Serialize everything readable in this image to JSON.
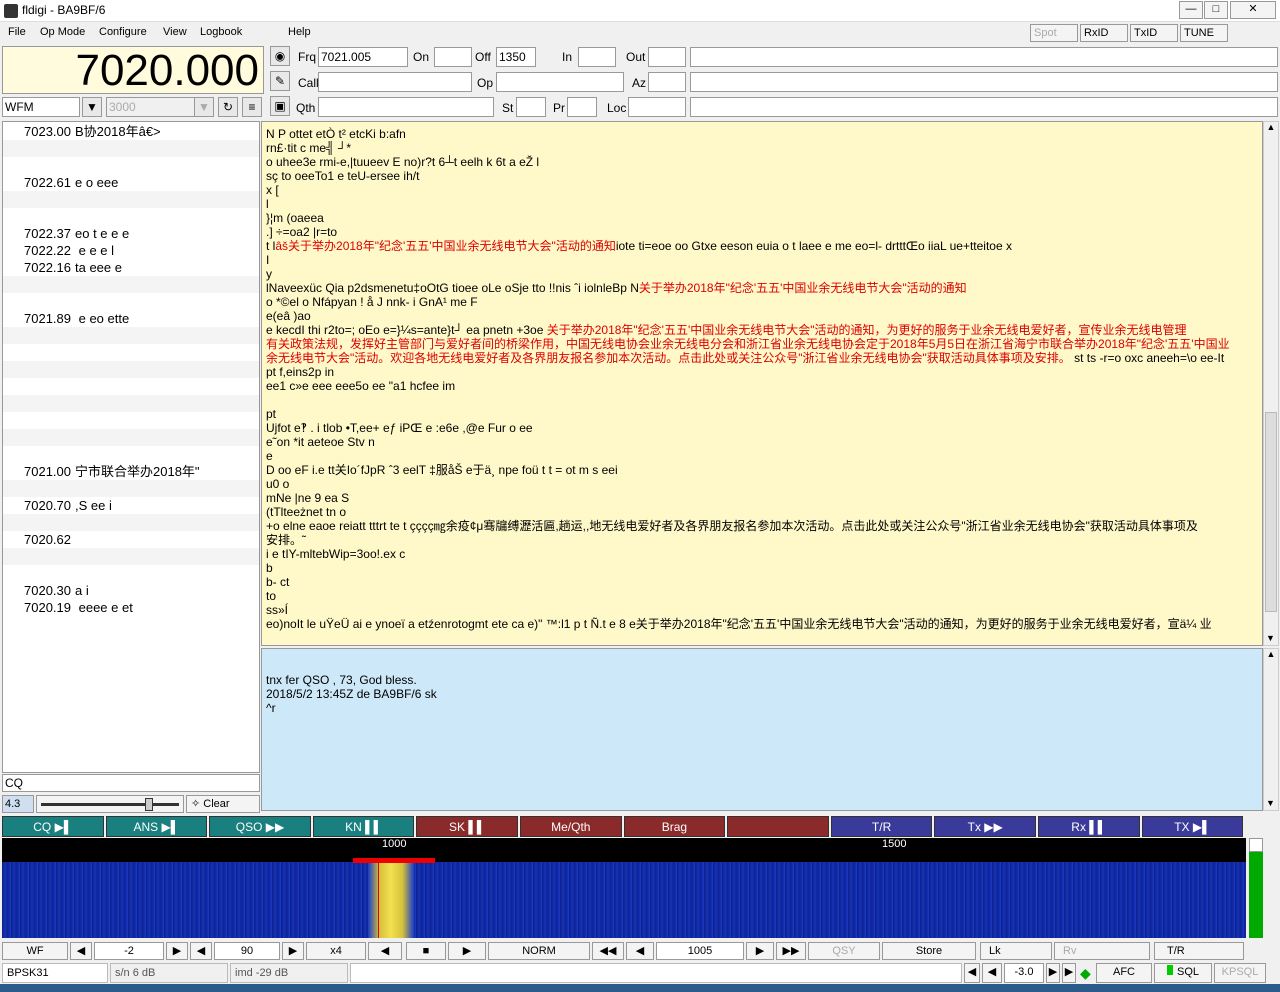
{
  "window": {
    "title": "fldigi - BA9BF/6"
  },
  "menu": [
    "File",
    "Op Mode",
    "Configure",
    "View",
    "Logbook",
    "Help"
  ],
  "toolbar_right": [
    "Spot",
    "RxID",
    "TxID",
    "TUNE"
  ],
  "freq": {
    "display": "7020.000",
    "mode": "WFM",
    "bandwidth": "3000"
  },
  "log": {
    "frq_label": "Frq",
    "frq": "7021.005",
    "on_label": "On",
    "on": "",
    "off_label": "Off",
    "off": "1350",
    "in_label": "In",
    "in": "",
    "out_label": "Out",
    "out": "",
    "call_label": "Call",
    "call": "",
    "op_label": "Op",
    "op": "",
    "az_label": "Az",
    "az": "",
    "qth_label": "Qth",
    "qth": "",
    "st_label": "St",
    "st": "",
    "pr_label": "Pr",
    "pr": "",
    "loc_label": "Loc",
    "loc": ""
  },
  "browser": [
    {
      "f": "7023.00",
      "t": "B协2018年â€>"
    },
    {
      "f": "7022.61",
      "t": "e  o    eee"
    },
    {
      "f": "7022.37",
      "t": "eo  t e e e"
    },
    {
      "f": "7022.22",
      "t": " e   e e l"
    },
    {
      "f": "7022.16",
      "t": "ta eee    e"
    },
    {
      "f": "7021.89",
      "t": " e  eo  ette"
    },
    {
      "f": "7021.00",
      "t": "宁市联合举办2018年\""
    },
    {
      "f": "7020.70",
      "t": ",S  ee i"
    },
    {
      "f": "7020.62",
      "t": ""
    },
    {
      "f": "7020.30",
      "t": "a i"
    },
    {
      "f": "7020.19",
      "t": " eeee    e et"
    }
  ],
  "rx_lines": [
    {
      "t": "N P  ottet  etÒ t² etcKi b:afn",
      "r": ""
    },
    {
      "t": " rn£·tit c me╣ ┘*",
      "r": ""
    },
    {
      "t": "o uhee3e rmi-e,|tuueev E no)r?t  6┴t eelh k 6t  a    eŽ l",
      "r": ""
    },
    {
      "t": "sç  to oeeTo1  e teU-ersee ih/t",
      "r": ""
    },
    {
      "t": "x [",
      "r": ""
    },
    {
      "t": "l",
      "r": ""
    },
    {
      "t": "}¦m  (oaeea",
      "r": ""
    },
    {
      "t": ".] ÷=oa2 |r=to",
      "r": ""
    },
    {
      "t": "t l",
      "r": "âš关于举办2018年\"纪念'五五'中国业余无线电节大会\"活动的通知",
      "t2": "iote ti=eoe oo Gtxe eeson euia    o t           laee    e  me eo=l-   drtttŒo iiaL ue+tteitoe x"
    },
    {
      "t": "I",
      "r": ""
    },
    {
      "t": "y",
      "r": ""
    },
    {
      "t": "lNaveexüc Qia p2dsmenetu‡oOtG tioee  oLe oSje  tto !!nis ˆi iolnleBp N",
      "r": "关于举办2018年\"纪念'五五'中国业余无线电节大会\"活动的通知"
    },
    {
      "t": "o *©el o Nfápyan ! å J nnk- i GnA¹ me F",
      "r": ""
    },
    {
      "t": "e(eâ )ao",
      "r": ""
    },
    {
      "t": "e  kecdI   thi r2to=; oEo    e=}¼s=ante}t┘ ea pnetn  +3oe ",
      "r": "关于举办2018年\"纪念'五五'中国业余无线电节大会\"活动的通知，为更好的服务于业余无线电爱好者，宣传业余无线电管理"
    },
    {
      "t": "",
      "r": "有关政策法规，发挥好主管部门与爱好者间的桥梁作用，中国无线电协会业余无线电分会和浙江省业余无线电协会定于2018年5月5日在浙江省海宁市联合举办2018年\"纪念'五五'中国业"
    },
    {
      "t": "",
      "r": "余无线电节大会\"活动。欢迎各地无线电爱好者及各界朋友报名参加本次活动。点击此处或关注公众号\"浙江省业余无线电协会\"获取活动具体事项及安排。",
      "t2": " st   ts -r=o oxc aneeh=\\o ee-It"
    },
    {
      "t": "pt  f,eins2p in",
      "r": ""
    },
    {
      "t": "ee1  c»e eee eee5o   ee \"a1     hcfee im",
      "r": ""
    },
    {
      "t": "",
      "r": ""
    },
    {
      "t": "pt",
      "r": ""
    },
    {
      "t": "Ujfot  e‽ . i    tlob •T,ee+ eƒ iPŒ e  :e6e  ,@e Fur o   ee",
      "r": ""
    },
    {
      "t": "e˜on *it  aeteoe  Stv    n",
      "r": ""
    },
    {
      "t": " e",
      "r": ""
    },
    {
      "t": "D oo   eF  i.e tt关Io´fJpR   ˆ3    eelT ‡服åŠ  e于ä¸ npe  foü                                                     t t                      =    ot  m s eei",
      "r": ""
    },
    {
      "t": " u0 o",
      "r": ""
    },
    {
      "t": " mNe |ne 9 ea S",
      "r": ""
    },
    {
      "t": "(tTlteeżnet tn o",
      "r": ""
    },
    {
      "t": "+o  elne eaoe reiatt tttrt te      t      çççç㎎余疫¢μ骞牖缚瀝活匾,趟运,,地无线电爱好者及各界朋友报名参加本次活动。点击此处或关注公众号\"浙江省业余无线电协会\"获取活动具体事项及",
      "r": ""
    },
    {
      "t": "安排。˜",
      "r": ""
    },
    {
      "t": " i  e  tIY-mltebWip=3oo!.ex c",
      "r": ""
    },
    {
      "t": " b",
      "r": ""
    },
    {
      "t": "b- ct",
      "r": ""
    },
    {
      "t": "to",
      "r": ""
    },
    {
      "t": " ss»Í",
      "r": ""
    },
    {
      "t": " eo)noIt le uŸeÜ ai e ynoeï a    etźenrotogmt  ete    ca   e)\"  ™:l1 p t Ñ.t e  8 e关于举办2018年\"纪念'五五'中国业余无线电节大会\"活动的通知，为更好的服务于业余无线电爱好者，宣ä¼ 业",
      "r": ""
    }
  ],
  "tx_lines": [
    "tnx fer QSO , 73, God bless.",
    "2018/5/2 13:45Z  de BA9BF/6 sk",
    "^r"
  ],
  "cq_field": "CQ",
  "squelch": {
    "value": "4.3",
    "clear_label": "Clear"
  },
  "macros": [
    {
      "label": "CQ ▶▌",
      "c": "m1"
    },
    {
      "label": "ANS ▶▌",
      "c": "m1"
    },
    {
      "label": "QSO ▶▶",
      "c": "m1"
    },
    {
      "label": "KN ▌▌",
      "c": "m1"
    },
    {
      "label": "SK ▌▌",
      "c": "m2"
    },
    {
      "label": "Me/Qth",
      "c": "m2"
    },
    {
      "label": "Brag",
      "c": "m2"
    },
    {
      "label": "",
      "c": "m2"
    },
    {
      "label": "T/R",
      "c": "m3"
    },
    {
      "label": "Tx ▶▶",
      "c": "m3"
    },
    {
      "label": "Rx ▌▌",
      "c": "m3"
    },
    {
      "label": "TX ▶▌",
      "c": "m3"
    }
  ],
  "macro_page": "1",
  "ruler": {
    "t1": "1000",
    "t2": "1500"
  },
  "controls": {
    "wf": "WF",
    "ref": "-2",
    "range": "90",
    "zoom": "x4",
    "speed": "NORM",
    "carrier": "1005",
    "qsy": "QSY",
    "store": "Store",
    "lk": "Lk",
    "rv": "Rv",
    "tr": "T/R"
  },
  "status": {
    "mode": "BPSK31",
    "sn": "s/n  6 dB",
    "imd": "imd -29 dB",
    "afc_val": "-3.0",
    "afc": "AFC",
    "sql": "SQL",
    "kpsql": "KPSQL"
  }
}
